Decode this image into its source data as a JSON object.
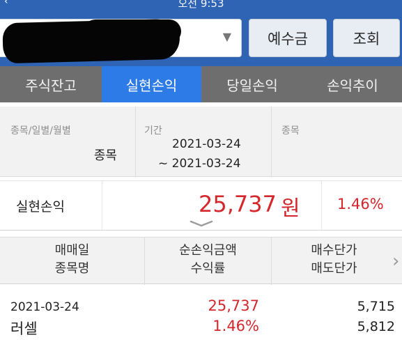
{
  "status_bar": {
    "time": "오전 9:53"
  },
  "header": {
    "account_caret": "▼",
    "deposit_button": "예수금",
    "query_button": "조회"
  },
  "tabs": [
    {
      "label": "주식잔고",
      "active": false
    },
    {
      "label": "실현손익",
      "active": true
    },
    {
      "label": "당일손익",
      "active": false
    },
    {
      "label": "손익추이",
      "active": false
    }
  ],
  "filter": {
    "type_caption": "종목/일별/월별",
    "type_value": "종목",
    "period_caption": "기간",
    "period_start": "2021-03-24",
    "period_end": "~ 2021-03-24",
    "stock_caption": "종목"
  },
  "summary": {
    "label": "실현손익",
    "amount": "25,737",
    "unit": "원",
    "rate": "1.46%"
  },
  "table": {
    "headers": [
      [
        "매매일",
        "종목명"
      ],
      [
        "순손익금액",
        "수익률"
      ],
      [
        "매수단가",
        "매도단가"
      ]
    ],
    "more_arrow": "›",
    "rows": [
      {
        "date": "2021-03-24",
        "name": "러셀",
        "amount": "25,737",
        "rate": "1.46%",
        "buy_price": "5,715",
        "sell_price": "5,812"
      }
    ]
  },
  "colors": {
    "header_blue": "#2f63b4",
    "active_tab": "#2c7be6",
    "profit_red": "#d4262b"
  }
}
